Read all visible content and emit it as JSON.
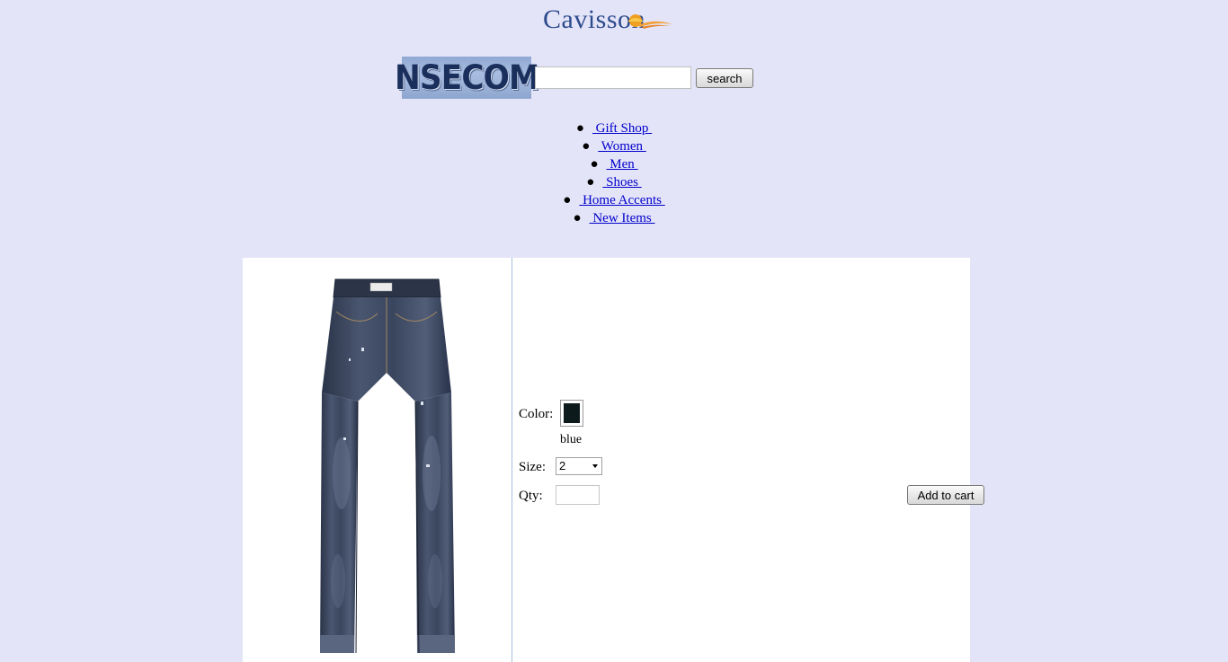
{
  "header": {
    "brand_logo_text": "Cavisson",
    "store_logo_text": "NSECOM"
  },
  "search": {
    "value": "",
    "placeholder": "",
    "button_label": "search"
  },
  "nav": {
    "items": [
      {
        "label": " Gift Shop "
      },
      {
        "label": " Women "
      },
      {
        "label": " Men "
      },
      {
        "label": " Shoes "
      },
      {
        "label": " Home Accents "
      },
      {
        "label": " New Items "
      }
    ]
  },
  "product": {
    "image_icon": "jeans-image",
    "color_label": "Color:",
    "color_name": "blue",
    "color_hex": "#0d1a1c",
    "size_label": "Size:",
    "size_value": "2",
    "qty_label": "Qty:",
    "qty_value": "",
    "add_to_cart_label": "Add to cart"
  },
  "colors": {
    "page_background": "#e4e4f8",
    "link": "#0000cc",
    "brand_blue": "#2d4b8c",
    "brand_orange": "#f0a020"
  }
}
